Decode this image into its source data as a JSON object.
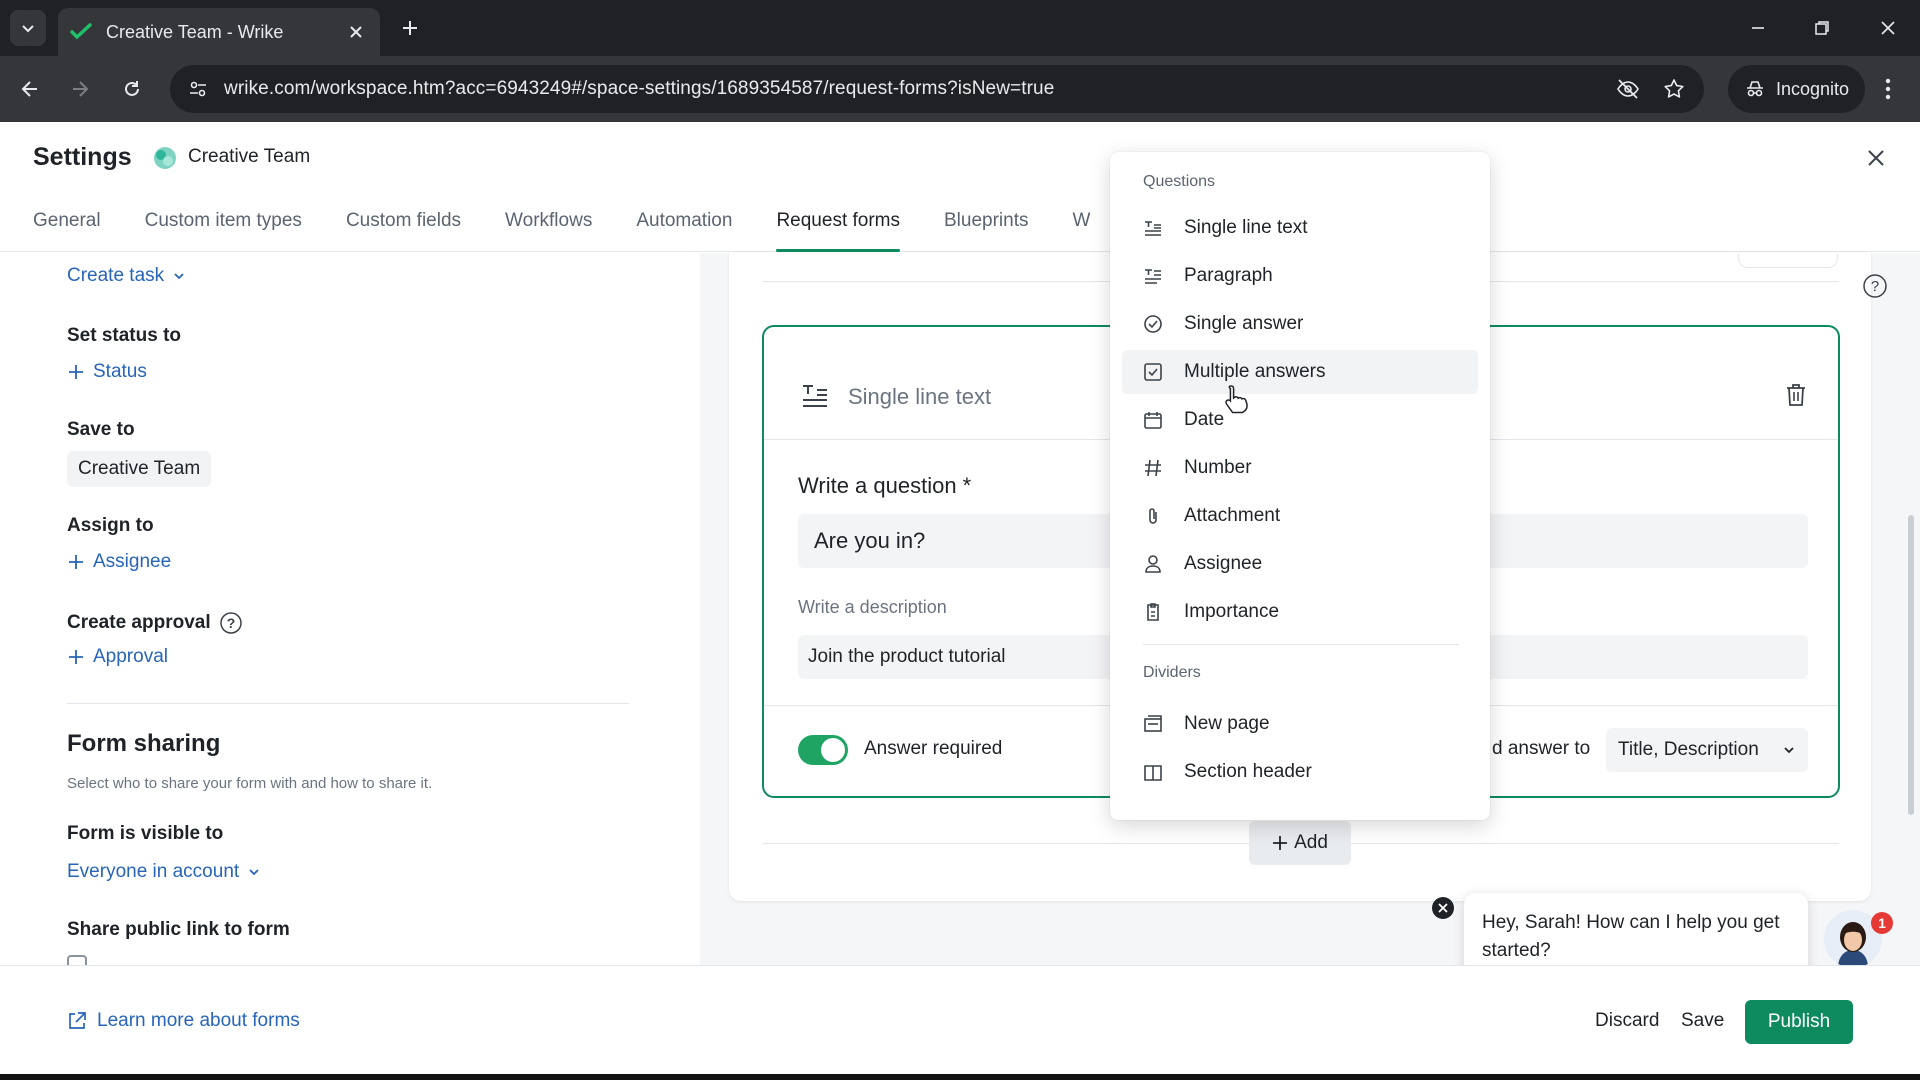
{
  "browser": {
    "tab_title": "Creative Team - Wrike",
    "url": "wrike.com/workspace.htm?acc=6943249#/space-settings/1689354587/request-forms?isNew=true",
    "incognito_label": "Incognito"
  },
  "settings": {
    "title": "Settings",
    "space_name": "Creative Team",
    "tabs": [
      "General",
      "Custom item types",
      "Custom fields",
      "Workflows",
      "Automation",
      "Request forms",
      "Blueprints",
      "W"
    ],
    "active_tab": "Request forms"
  },
  "left_panel": {
    "create_task": "Create task",
    "set_status_label": "Set status to",
    "status_link": "Status",
    "save_to_label": "Save to",
    "save_to_value": "Creative Team",
    "assign_to_label": "Assign to",
    "assignee_link": "Assignee",
    "approval_label": "Create approval",
    "approval_link": "Approval",
    "form_sharing_title": "Form sharing",
    "form_sharing_sub": "Select who to share your form with and how to share it.",
    "visible_to_label": "Form is visible to",
    "visible_to_value": "Everyone in account",
    "public_link_label": "Share public link to form"
  },
  "question_card": {
    "type_label": "Single line text",
    "question_label": "Write a question *",
    "question_value": "Are you in?",
    "description_label": "Write a description",
    "description_value": "Join the product tutorial",
    "toggle_label": "Answer required",
    "toggle_on": true,
    "map_label": "d answer to",
    "map_value": "Title, Description"
  },
  "add_button": "Add",
  "dropdown": {
    "questions_title": "Questions",
    "question_items": [
      {
        "label": "Single line text",
        "icon": "single-line-text-icon"
      },
      {
        "label": "Paragraph",
        "icon": "paragraph-icon"
      },
      {
        "label": "Single answer",
        "icon": "single-answer-icon"
      },
      {
        "label": "Multiple answers",
        "icon": "multiple-answers-icon"
      },
      {
        "label": "Date",
        "icon": "calendar-icon"
      },
      {
        "label": "Number",
        "icon": "hash-icon"
      },
      {
        "label": "Attachment",
        "icon": "paperclip-icon"
      },
      {
        "label": "Assignee",
        "icon": "person-icon"
      },
      {
        "label": "Importance",
        "icon": "importance-icon"
      }
    ],
    "hovered_item": "Multiple answers",
    "dividers_title": "Dividers",
    "divider_items": [
      {
        "label": "New page",
        "icon": "new-page-icon"
      },
      {
        "label": "Section header",
        "icon": "section-header-icon"
      }
    ]
  },
  "chat": {
    "message": "Hey, Sarah! How can I help you get started?",
    "badge": "1"
  },
  "footer": {
    "learn_more": "Learn more about forms",
    "discard": "Discard",
    "save": "Save",
    "publish": "Publish"
  },
  "colors": {
    "accent_green": "#0e8a5f",
    "link_blue": "#2765b8"
  }
}
